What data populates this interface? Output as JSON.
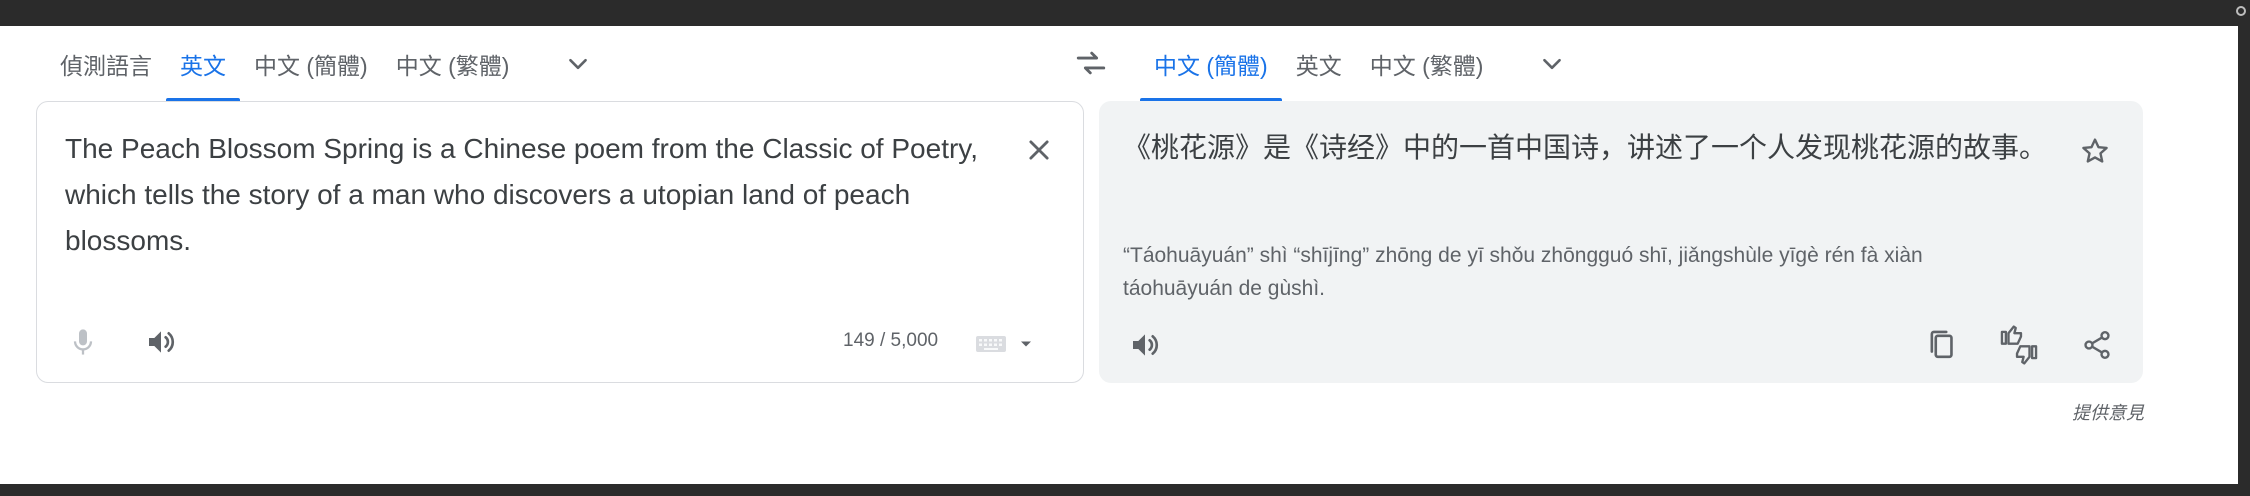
{
  "source_languages": {
    "tabs": [
      {
        "label": "偵測語言"
      },
      {
        "label": "英文"
      },
      {
        "label": "中文 (簡體)"
      },
      {
        "label": "中文 (繁體)"
      }
    ],
    "active_index": 1
  },
  "target_languages": {
    "tabs": [
      {
        "label": "中文 (簡體)"
      },
      {
        "label": "英文"
      },
      {
        "label": "中文 (繁體)"
      }
    ],
    "active_index": 0
  },
  "source": {
    "text": "The Peach Blossom Spring is a Chinese poem from the Classic of Poetry, which tells the story of a man who discovers a utopian land of peach blossoms.",
    "char_count": "149 / 5,000"
  },
  "target": {
    "text": "《桃花源》是《诗经》中的一首中国诗，讲述了一个人发现桃花源的故事。",
    "transliteration": "“Táohuāyuán” shì “shījīng” zhōng de yī shǒu zhōngguó shī, jiǎngshùle yīgè rén fà xiàn táohuāyuán de gùshì."
  },
  "footer": {
    "feedback_label": "提供意見"
  },
  "icons": {
    "swap": "swap-languages-icon",
    "more": "chevron-down-icon",
    "clear": "close-icon",
    "mic": "microphone-icon",
    "speaker": "speaker-icon",
    "keyboard": "keyboard-icon",
    "star": "star-icon",
    "copy": "copy-icon",
    "rate": "thumbs-icon",
    "share": "share-icon"
  },
  "colors": {
    "accent": "#1a73e8",
    "text": "#3c4043",
    "muted": "#5f6368",
    "target_bg": "#f1f3f4"
  }
}
